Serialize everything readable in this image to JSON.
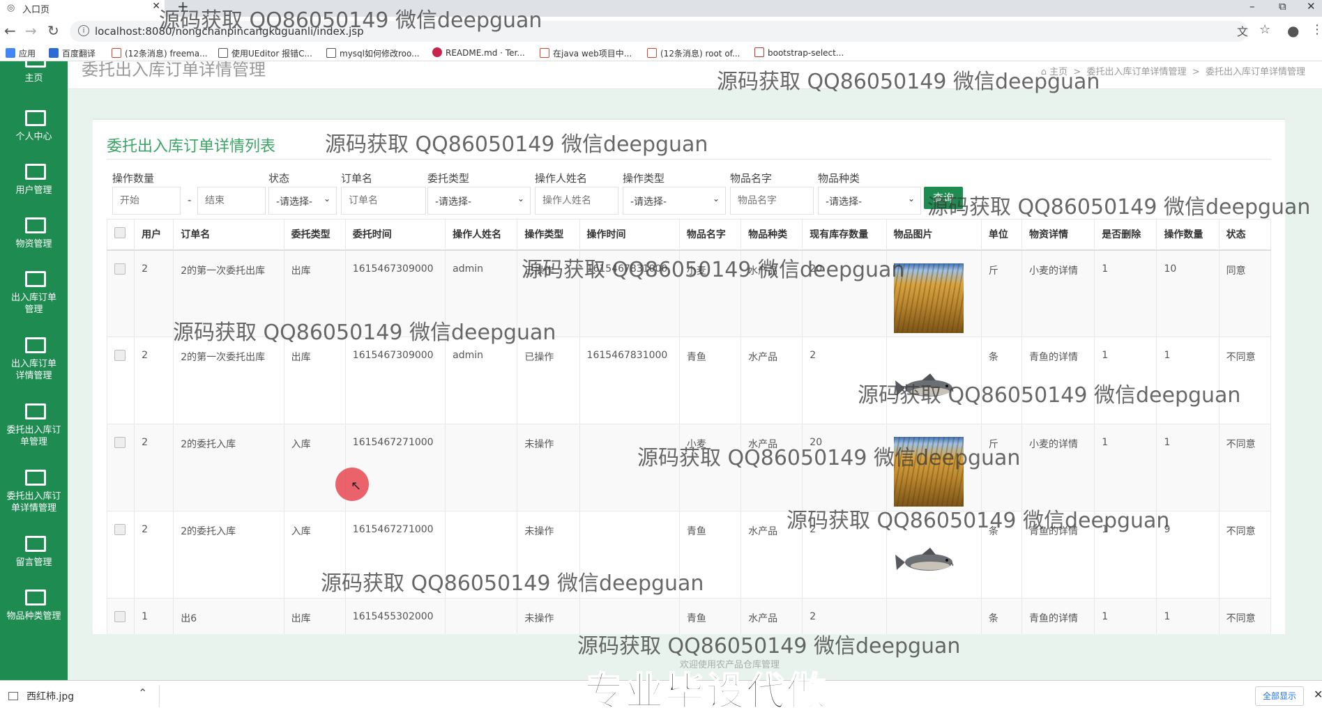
{
  "browser": {
    "tab_title": "入口页",
    "url": "localhost:8080/nongchanpincangkuguanli/index.jsp",
    "bookmarks": [
      {
        "label": "应用",
        "color": "#4285f4"
      },
      {
        "label": "百度翻译",
        "color": "#2a6bd6"
      },
      {
        "label": "(12条消息) freema...",
        "color": "#d9442e"
      },
      {
        "label": "使用UEditor 报错C...",
        "color": "#555555"
      },
      {
        "label": "mysql如何修改roo...",
        "color": "#555555"
      },
      {
        "label": "README.md · Ter...",
        "color": "#c7254e"
      },
      {
        "label": "在java web项目中...",
        "color": "#d9442e"
      },
      {
        "label": "(12条消息) root of...",
        "color": "#d9442e"
      },
      {
        "label": "bootstrap-select...",
        "color": "#c0392b"
      }
    ]
  },
  "sidebar": {
    "items": [
      {
        "label": "主页"
      },
      {
        "label": "个人中心"
      },
      {
        "label": "用户管理"
      },
      {
        "label": "物资管理"
      },
      {
        "label": "出入库订单管理"
      },
      {
        "label": "出入库订单详情管理"
      },
      {
        "label": "委托出入库订单管理"
      },
      {
        "label": "委托出入库订单详情管理"
      },
      {
        "label": "留言管理"
      },
      {
        "label": "物品种类管理"
      }
    ]
  },
  "header": {
    "page_title": "委托出入库订单详情管理",
    "breadcrumb": [
      "主页",
      "委托出入库订单详情管理",
      "委托出入库订单详情管理"
    ]
  },
  "card": {
    "title": "委托出入库订单详情列表"
  },
  "filters": {
    "op_qty_label": "操作数量",
    "op_qty_start_placeholder": "开始",
    "op_qty_dash": "-",
    "op_qty_end_placeholder": "结束",
    "status_label": "状态",
    "status_value": "-请选择-",
    "order_name_label": "订单名",
    "order_name_placeholder": "订单名",
    "entrust_type_label": "委托类型",
    "entrust_type_value": "-请选择-",
    "operator_label": "操作人姓名",
    "operator_placeholder": "操作人姓名",
    "op_type_label": "操作类型",
    "op_type_value": "-请选择-",
    "item_name_label": "物品名字",
    "item_name_placeholder": "物品名字",
    "item_kind_label": "物品种类",
    "item_kind_value": "-请选择-",
    "search_button": "查询"
  },
  "table": {
    "columns": [
      "用户",
      "订单名",
      "委托类型",
      "委托时间",
      "操作人姓名",
      "操作类型",
      "操作时间",
      "物品名字",
      "物品种类",
      "现有库存数量",
      "物品图片",
      "单位",
      "物资详情",
      "是否删除",
      "操作数量",
      "状态"
    ],
    "rows": [
      {
        "user": "2",
        "order": "2的第一次委托出库",
        "type": "出库",
        "time": "1615467309000",
        "operator": "admin",
        "op_type": "已操作",
        "op_time": "1615467831000",
        "item": "小麦",
        "kind": "水产品",
        "stock": "20",
        "image": "wheat",
        "unit": "斤",
        "detail": "小麦的详情",
        "deleted": "1",
        "qty": "10",
        "status": "同意"
      },
      {
        "user": "2",
        "order": "2的第一次委托出库",
        "type": "出库",
        "time": "1615467309000",
        "operator": "admin",
        "op_type": "已操作",
        "op_time": "1615467831000",
        "item": "青鱼",
        "kind": "水产品",
        "stock": "2",
        "image": "fish",
        "unit": "条",
        "detail": "青鱼的详情",
        "deleted": "1",
        "qty": "1",
        "status": "不同意"
      },
      {
        "user": "2",
        "order": "2的委托入库",
        "type": "入库",
        "time": "1615467271000",
        "operator": "",
        "op_type": "未操作",
        "op_time": "",
        "item": "小麦",
        "kind": "水产品",
        "stock": "20",
        "image": "wheat",
        "unit": "斤",
        "detail": "小麦的详情",
        "deleted": "1",
        "qty": "1",
        "status": "不同意"
      },
      {
        "user": "2",
        "order": "2的委托入库",
        "type": "入库",
        "time": "1615467271000",
        "operator": "",
        "op_type": "未操作",
        "op_time": "",
        "item": "青鱼",
        "kind": "水产品",
        "stock": "2",
        "image": "fish",
        "unit": "条",
        "detail": "青鱼的详情",
        "deleted": "1",
        "qty": "9",
        "status": "不同意"
      },
      {
        "user": "1",
        "order": "出6",
        "type": "出库",
        "time": "1615455302000",
        "operator": "",
        "op_type": "未操作",
        "op_time": "",
        "item": "青鱼",
        "kind": "水产品",
        "stock": "2",
        "image": "fish",
        "unit": "条",
        "detail": "青鱼的详情",
        "deleted": "1",
        "qty": "1",
        "status": "不同意"
      }
    ]
  },
  "footer_note": "欢迎使用农产品仓库管理",
  "overlay": {
    "watermark": "源码获取 QQ86050149 微信deepguan",
    "banner": "专业毕设代做"
  },
  "download_bar": {
    "file": "西红柿.jpg",
    "show_all": "全部显示"
  }
}
